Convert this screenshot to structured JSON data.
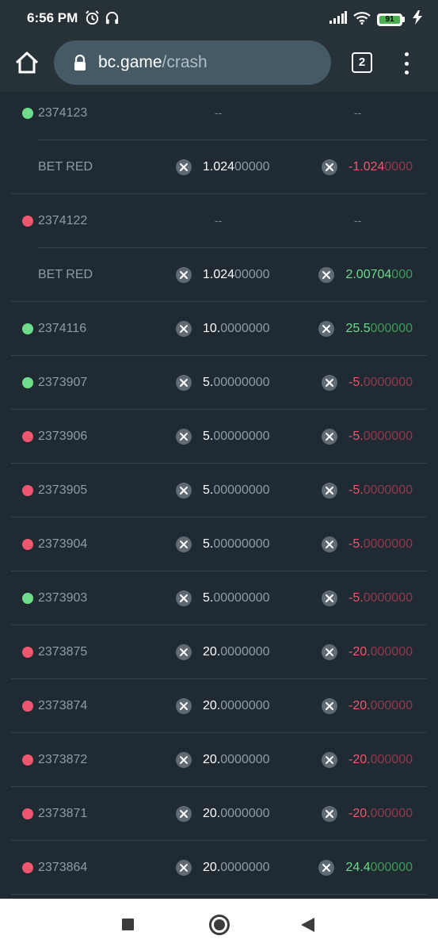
{
  "status_bar": {
    "time": "6:56 PM",
    "battery": "91",
    "icons": [
      "alarm-icon",
      "headset-icon",
      "signal-icon",
      "wifi-icon",
      "battery-icon",
      "charging-icon"
    ]
  },
  "browser": {
    "url_host": "bc.game",
    "url_path": "/crash",
    "tab_count": "2"
  },
  "rows": [
    {
      "kind": "round",
      "dot": "green",
      "id": "2374123",
      "bet": "--",
      "profit": "--"
    },
    {
      "kind": "sub",
      "label": "BET RED",
      "bet_bold": "1.024",
      "bet_dim": "00000",
      "profit_sign": "neg",
      "profit_bold": "-1.024",
      "profit_dim": "0000"
    },
    {
      "kind": "round",
      "dot": "red",
      "id": "2374122",
      "bet": "--",
      "profit": "--"
    },
    {
      "kind": "sub",
      "label": "BET RED",
      "bet_bold": "1.024",
      "bet_dim": "00000",
      "profit_sign": "pos",
      "profit_bold": "2.00704",
      "profit_dim": "000"
    },
    {
      "kind": "bet",
      "dot": "green",
      "id": "2374116",
      "bet_bold": "10.",
      "bet_dim": "0000000",
      "profit_sign": "pos",
      "profit_bold": "25.5",
      "profit_dim": "000000"
    },
    {
      "kind": "bet",
      "dot": "green",
      "id": "2373907",
      "bet_bold": "5.",
      "bet_dim": "00000000",
      "profit_sign": "neg",
      "profit_bold": "-5.",
      "profit_dim": "0000000"
    },
    {
      "kind": "bet",
      "dot": "red",
      "id": "2373906",
      "bet_bold": "5.",
      "bet_dim": "00000000",
      "profit_sign": "neg",
      "profit_bold": "-5.",
      "profit_dim": "0000000"
    },
    {
      "kind": "bet",
      "dot": "red",
      "id": "2373905",
      "bet_bold": "5.",
      "bet_dim": "00000000",
      "profit_sign": "neg",
      "profit_bold": "-5.",
      "profit_dim": "0000000"
    },
    {
      "kind": "bet",
      "dot": "red",
      "id": "2373904",
      "bet_bold": "5.",
      "bet_dim": "00000000",
      "profit_sign": "neg",
      "profit_bold": "-5.",
      "profit_dim": "0000000"
    },
    {
      "kind": "bet",
      "dot": "green",
      "id": "2373903",
      "bet_bold": "5.",
      "bet_dim": "00000000",
      "profit_sign": "neg",
      "profit_bold": "-5.",
      "profit_dim": "0000000"
    },
    {
      "kind": "bet",
      "dot": "red",
      "id": "2373875",
      "bet_bold": "20.",
      "bet_dim": "0000000",
      "profit_sign": "neg",
      "profit_bold": "-20.",
      "profit_dim": "000000"
    },
    {
      "kind": "bet",
      "dot": "red",
      "id": "2373874",
      "bet_bold": "20.",
      "bet_dim": "0000000",
      "profit_sign": "neg",
      "profit_bold": "-20.",
      "profit_dim": "000000"
    },
    {
      "kind": "bet",
      "dot": "red",
      "id": "2373872",
      "bet_bold": "20.",
      "bet_dim": "0000000",
      "profit_sign": "neg",
      "profit_bold": "-20.",
      "profit_dim": "000000"
    },
    {
      "kind": "bet",
      "dot": "red",
      "id": "2373871",
      "bet_bold": "20.",
      "bet_dim": "0000000",
      "profit_sign": "neg",
      "profit_bold": "-20.",
      "profit_dim": "000000"
    },
    {
      "kind": "bet",
      "dot": "red",
      "id": "2373864",
      "bet_bold": "20.",
      "bet_dim": "0000000",
      "profit_sign": "pos",
      "profit_bold": "24.4",
      "profit_dim": "000000"
    }
  ],
  "colors": {
    "background": "#1f2a33",
    "toolbar": "#263238",
    "win_green": "#6fdc8c",
    "loss_red": "#f0576e"
  },
  "nav": {
    "icons": [
      "recents-icon",
      "home-circle-icon",
      "back-icon"
    ]
  }
}
